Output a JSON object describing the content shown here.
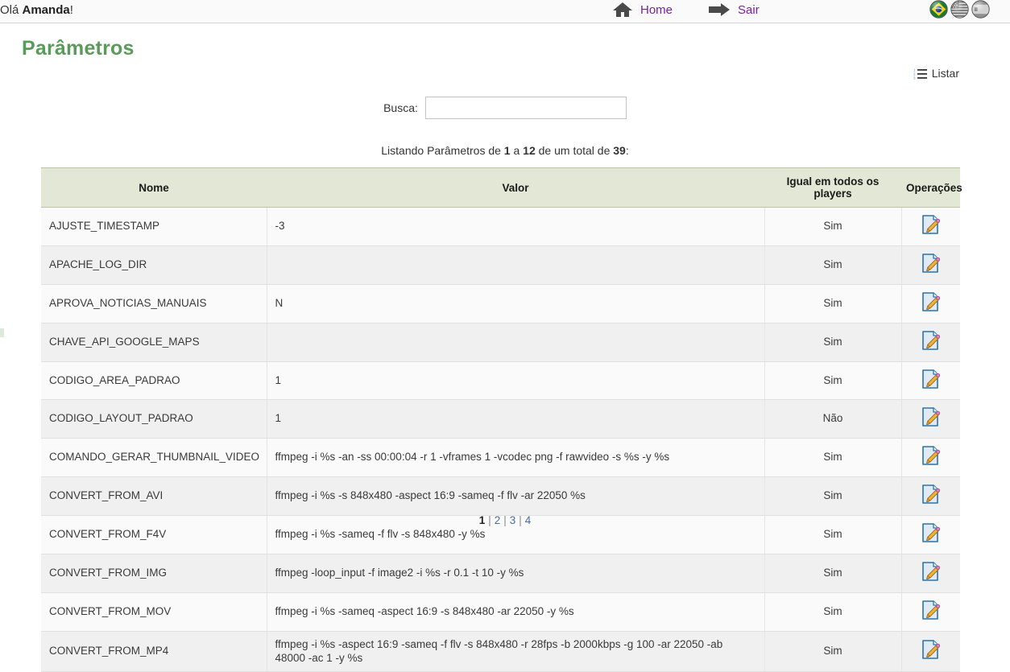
{
  "topbar": {
    "greeting_prefix": "Olá ",
    "greeting_user": "Amanda",
    "greeting_suffix": "!",
    "nav": [
      {
        "label": "Home",
        "icon": "home-icon"
      },
      {
        "label": "Sair",
        "icon": "arrow-right-icon"
      }
    ],
    "flags": [
      {
        "name": "flag-brazil",
        "active": true
      },
      {
        "name": "flag-usa",
        "active": false
      },
      {
        "name": "flag-spain",
        "active": false
      }
    ]
  },
  "page": {
    "title": "Parâmetros",
    "title_color": "#5a9a5a"
  },
  "actions": {
    "listar_label": "Listar",
    "listar_icon": "list-icon"
  },
  "search": {
    "label": "Busca:",
    "value": "",
    "placeholder": ""
  },
  "summary": {
    "prefix": "Listando Parâmetros de ",
    "from": "1",
    "mid1": " a ",
    "to": "12",
    "mid2": " de um total de ",
    "total": "39",
    "suffix": ":"
  },
  "table": {
    "columns": [
      "Nome",
      "Valor",
      "Igual em todos os players",
      "Operações"
    ],
    "edit_icon": "edit-document-icon",
    "rows": [
      {
        "nome": "AJUSTE_TIMESTAMP",
        "valor": "-3",
        "igual": "Sim"
      },
      {
        "nome": "APACHE_LOG_DIR",
        "valor": "",
        "igual": "Sim"
      },
      {
        "nome": "APROVA_NOTICIAS_MANUAIS",
        "valor": "N",
        "igual": "Sim"
      },
      {
        "nome": "CHAVE_API_GOOGLE_MAPS",
        "valor": "",
        "igual": "Sim"
      },
      {
        "nome": "CODIGO_AREA_PADRAO",
        "valor": "1",
        "igual": "Sim"
      },
      {
        "nome": "CODIGO_LAYOUT_PADRAO",
        "valor": "1",
        "igual": "Não"
      },
      {
        "nome": "COMANDO_GERAR_THUMBNAIL_VIDEO",
        "valor": "ffmpeg -i %s -an -ss 00:00:04 -r 1 -vframes 1 -vcodec png -f rawvideo -s %s -y %s",
        "igual": "Sim"
      },
      {
        "nome": "CONVERT_FROM_AVI",
        "valor": "ffmpeg -i %s -s 848x480 -aspect 16:9 -sameq -f flv -ar 22050 %s",
        "igual": "Sim"
      },
      {
        "nome": "CONVERT_FROM_F4V",
        "valor": "ffmpeg -i %s -sameq -f flv -s 848x480 -y %s",
        "igual": "Sim"
      },
      {
        "nome": "CONVERT_FROM_IMG",
        "valor": "ffmpeg -loop_input -f image2 -i %s -r 0.1 -t 10 -y %s",
        "igual": "Sim"
      },
      {
        "nome": "CONVERT_FROM_MOV",
        "valor": "ffmpeg -i %s -sameq -aspect 16:9 -s 848x480 -ar 22050 -y %s",
        "igual": "Sim"
      },
      {
        "nome": "CONVERT_FROM_MP4",
        "valor": "ffmpeg -i %s -aspect 16:9 -sameq -f flv -s 848x480 -r 28fps -b 2000kbps -g 100 -ar 22050 -ab 48000 -ac 1 -y %s",
        "igual": "Sim"
      }
    ]
  },
  "pagination": {
    "pages": [
      "1",
      "2",
      "3",
      "4"
    ],
    "current": "1",
    "separator": "|"
  }
}
